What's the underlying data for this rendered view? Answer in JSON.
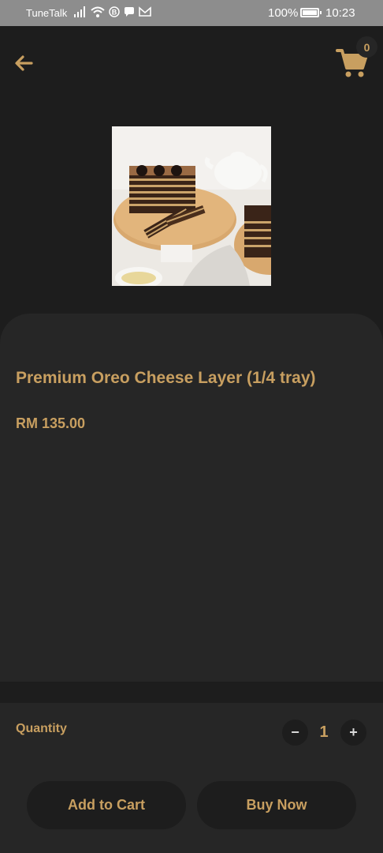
{
  "status_bar": {
    "carrier": "TuneTalk",
    "battery": "100%",
    "time": "10:23",
    "icons": [
      "signal-icon",
      "wifi-icon",
      "b-icon",
      "chat-icon",
      "mail-icon",
      "battery-icon"
    ]
  },
  "header": {
    "back_icon": "arrow-left-icon",
    "cart_icon": "cart-icon",
    "cart_count": "0"
  },
  "product": {
    "image": "oreo-cheese-layer-cake-photo",
    "title": "Premium Oreo Cheese Layer (1/4 tray)",
    "price": "RM 135.00"
  },
  "purchase": {
    "quantity_label": "Quantity",
    "quantity_value": "1",
    "minus_label": "−",
    "plus_label": "+",
    "add_to_cart_label": "Add to Cart",
    "buy_now_label": "Buy Now"
  },
  "colors": {
    "accent": "#c89f60",
    "background": "#1d1d1d",
    "panel": "#262626"
  }
}
